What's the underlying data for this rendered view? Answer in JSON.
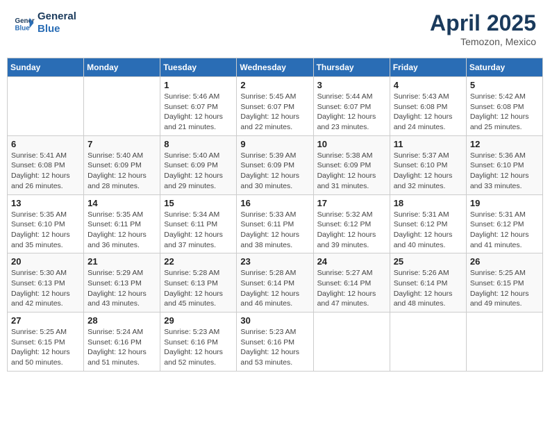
{
  "header": {
    "logo_line1": "General",
    "logo_line2": "Blue",
    "month": "April 2025",
    "location": "Temozon, Mexico"
  },
  "weekdays": [
    "Sunday",
    "Monday",
    "Tuesday",
    "Wednesday",
    "Thursday",
    "Friday",
    "Saturday"
  ],
  "weeks": [
    [
      {
        "date": "",
        "info": ""
      },
      {
        "date": "",
        "info": ""
      },
      {
        "date": "1",
        "info": "Sunrise: 5:46 AM\nSunset: 6:07 PM\nDaylight: 12 hours and 21 minutes."
      },
      {
        "date": "2",
        "info": "Sunrise: 5:45 AM\nSunset: 6:07 PM\nDaylight: 12 hours and 22 minutes."
      },
      {
        "date": "3",
        "info": "Sunrise: 5:44 AM\nSunset: 6:07 PM\nDaylight: 12 hours and 23 minutes."
      },
      {
        "date": "4",
        "info": "Sunrise: 5:43 AM\nSunset: 6:08 PM\nDaylight: 12 hours and 24 minutes."
      },
      {
        "date": "5",
        "info": "Sunrise: 5:42 AM\nSunset: 6:08 PM\nDaylight: 12 hours and 25 minutes."
      }
    ],
    [
      {
        "date": "6",
        "info": "Sunrise: 5:41 AM\nSunset: 6:08 PM\nDaylight: 12 hours and 26 minutes."
      },
      {
        "date": "7",
        "info": "Sunrise: 5:40 AM\nSunset: 6:09 PM\nDaylight: 12 hours and 28 minutes."
      },
      {
        "date": "8",
        "info": "Sunrise: 5:40 AM\nSunset: 6:09 PM\nDaylight: 12 hours and 29 minutes."
      },
      {
        "date": "9",
        "info": "Sunrise: 5:39 AM\nSunset: 6:09 PM\nDaylight: 12 hours and 30 minutes."
      },
      {
        "date": "10",
        "info": "Sunrise: 5:38 AM\nSunset: 6:09 PM\nDaylight: 12 hours and 31 minutes."
      },
      {
        "date": "11",
        "info": "Sunrise: 5:37 AM\nSunset: 6:10 PM\nDaylight: 12 hours and 32 minutes."
      },
      {
        "date": "12",
        "info": "Sunrise: 5:36 AM\nSunset: 6:10 PM\nDaylight: 12 hours and 33 minutes."
      }
    ],
    [
      {
        "date": "13",
        "info": "Sunrise: 5:35 AM\nSunset: 6:10 PM\nDaylight: 12 hours and 35 minutes."
      },
      {
        "date": "14",
        "info": "Sunrise: 5:35 AM\nSunset: 6:11 PM\nDaylight: 12 hours and 36 minutes."
      },
      {
        "date": "15",
        "info": "Sunrise: 5:34 AM\nSunset: 6:11 PM\nDaylight: 12 hours and 37 minutes."
      },
      {
        "date": "16",
        "info": "Sunrise: 5:33 AM\nSunset: 6:11 PM\nDaylight: 12 hours and 38 minutes."
      },
      {
        "date": "17",
        "info": "Sunrise: 5:32 AM\nSunset: 6:12 PM\nDaylight: 12 hours and 39 minutes."
      },
      {
        "date": "18",
        "info": "Sunrise: 5:31 AM\nSunset: 6:12 PM\nDaylight: 12 hours and 40 minutes."
      },
      {
        "date": "19",
        "info": "Sunrise: 5:31 AM\nSunset: 6:12 PM\nDaylight: 12 hours and 41 minutes."
      }
    ],
    [
      {
        "date": "20",
        "info": "Sunrise: 5:30 AM\nSunset: 6:13 PM\nDaylight: 12 hours and 42 minutes."
      },
      {
        "date": "21",
        "info": "Sunrise: 5:29 AM\nSunset: 6:13 PM\nDaylight: 12 hours and 43 minutes."
      },
      {
        "date": "22",
        "info": "Sunrise: 5:28 AM\nSunset: 6:13 PM\nDaylight: 12 hours and 45 minutes."
      },
      {
        "date": "23",
        "info": "Sunrise: 5:28 AM\nSunset: 6:14 PM\nDaylight: 12 hours and 46 minutes."
      },
      {
        "date": "24",
        "info": "Sunrise: 5:27 AM\nSunset: 6:14 PM\nDaylight: 12 hours and 47 minutes."
      },
      {
        "date": "25",
        "info": "Sunrise: 5:26 AM\nSunset: 6:14 PM\nDaylight: 12 hours and 48 minutes."
      },
      {
        "date": "26",
        "info": "Sunrise: 5:25 AM\nSunset: 6:15 PM\nDaylight: 12 hours and 49 minutes."
      }
    ],
    [
      {
        "date": "27",
        "info": "Sunrise: 5:25 AM\nSunset: 6:15 PM\nDaylight: 12 hours and 50 minutes."
      },
      {
        "date": "28",
        "info": "Sunrise: 5:24 AM\nSunset: 6:16 PM\nDaylight: 12 hours and 51 minutes."
      },
      {
        "date": "29",
        "info": "Sunrise: 5:23 AM\nSunset: 6:16 PM\nDaylight: 12 hours and 52 minutes."
      },
      {
        "date": "30",
        "info": "Sunrise: 5:23 AM\nSunset: 6:16 PM\nDaylight: 12 hours and 53 minutes."
      },
      {
        "date": "",
        "info": ""
      },
      {
        "date": "",
        "info": ""
      },
      {
        "date": "",
        "info": ""
      }
    ]
  ]
}
